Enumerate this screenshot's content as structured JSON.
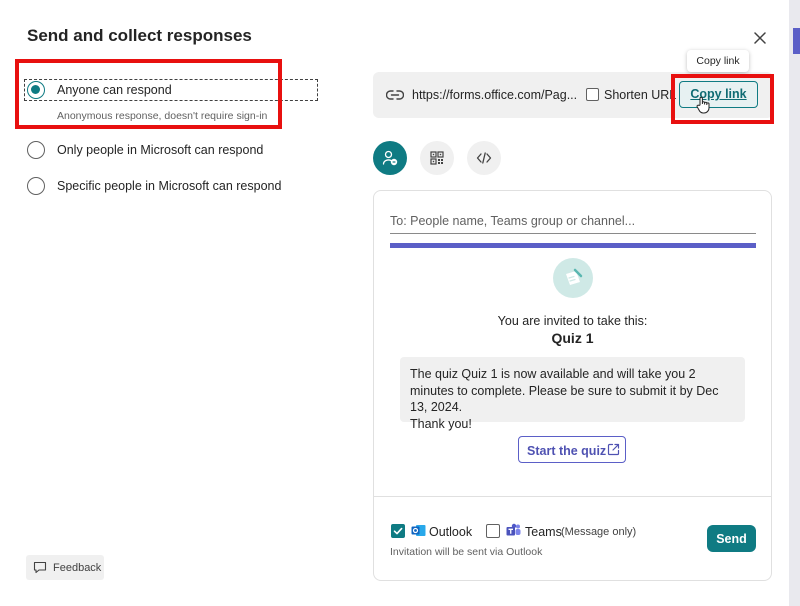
{
  "dialog": {
    "title": "Send and collect responses",
    "close_icon": "close-icon"
  },
  "audience": {
    "options": [
      {
        "label": "Anyone can respond",
        "selected": true,
        "sublabel": "Anonymous response, doesn't require sign-in"
      },
      {
        "label": "Only people in Microsoft can respond",
        "selected": false
      },
      {
        "label": "Specific people in Microsoft can respond",
        "selected": false
      }
    ]
  },
  "link": {
    "icon": "link-icon",
    "url": "https://forms.office.com/Pag...",
    "shorten_label": "Shorten URL",
    "shorten_checked": false,
    "copy_label": "Copy link",
    "tooltip": "Copy link"
  },
  "share_methods": [
    {
      "icon": "invite-people-icon",
      "active": true
    },
    {
      "icon": "qr-code-icon",
      "active": false
    },
    {
      "icon": "embed-code-icon",
      "active": false
    }
  ],
  "invite": {
    "to_placeholder": "To: People name, Teams group or channel...",
    "invited_text": "You are invited to take this:",
    "quiz_name": "Quiz 1",
    "message_line1": "The quiz Quiz 1 is now available and will take you 2 minutes to complete. Please be sure to submit it by Dec 13, 2024.",
    "message_line2": "Thank you!",
    "start_label": "Start the quiz",
    "outlook_label": "Outlook",
    "outlook_checked": true,
    "teams_label": "Teams",
    "teams_checked": false,
    "teams_note": "(Message only)",
    "invite_note": "Invitation will be sent via Outlook",
    "send_label": "Send"
  },
  "feedback": {
    "label": "Feedback"
  },
  "colors": {
    "accent": "#0f7b83",
    "teams_purple": "#5b5fc7",
    "highlight_red": "#e8100f"
  }
}
